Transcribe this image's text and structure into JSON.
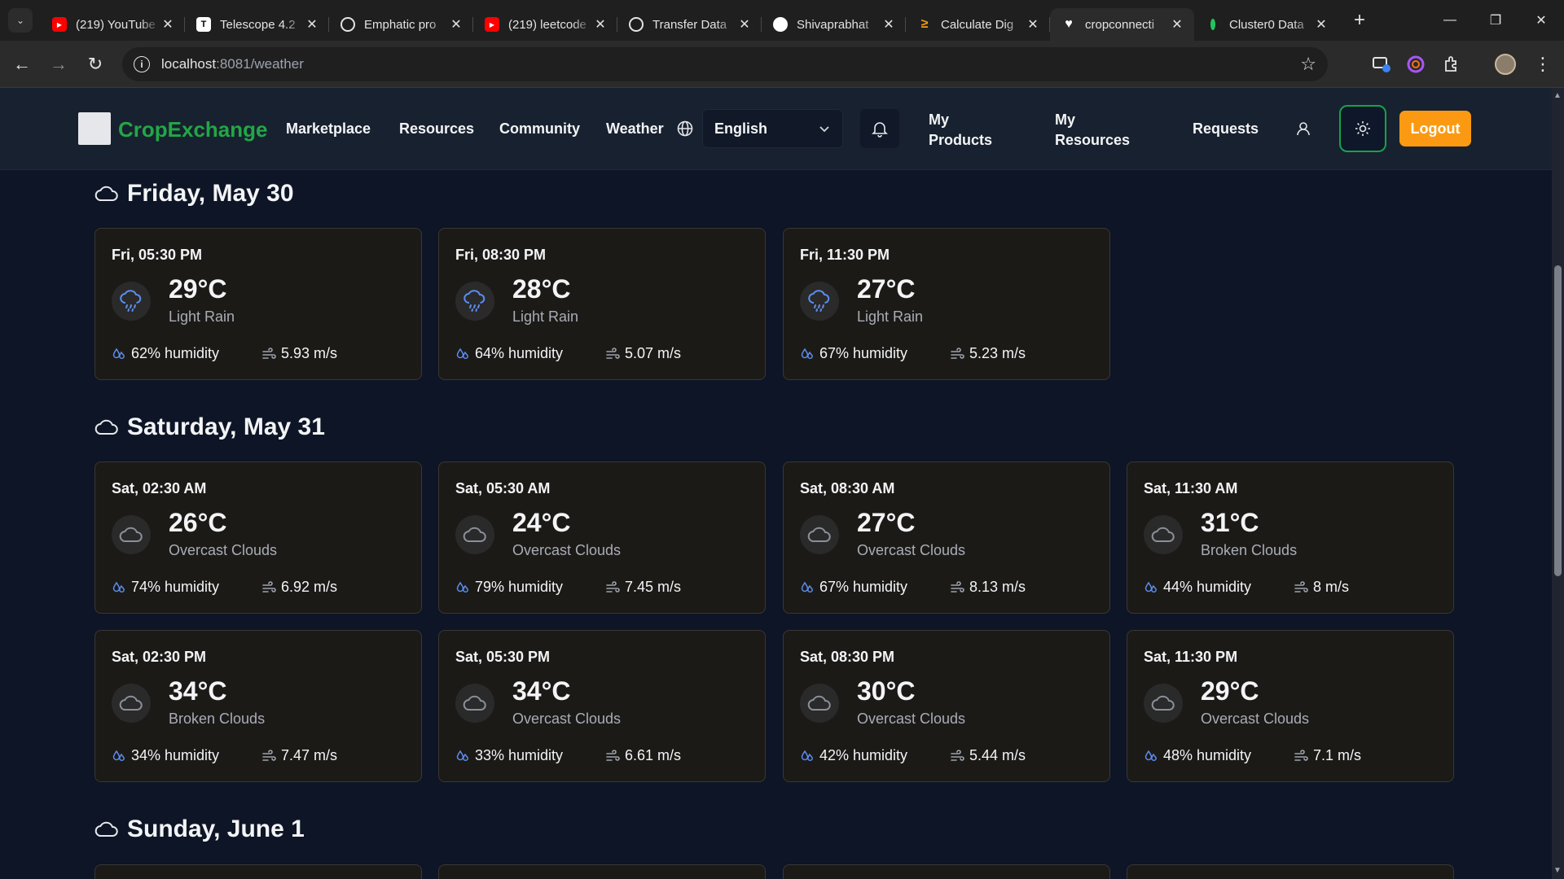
{
  "browser": {
    "tabs": [
      {
        "title": "(219) YouTube",
        "favicon": "youtube-icon",
        "color": "#ff0000"
      },
      {
        "title": "Telescope 4.2",
        "favicon": "telescope-icon",
        "color": "#ffffff"
      },
      {
        "title": "Emphatic pro",
        "favicon": "openai-icon",
        "color": "#ffffff"
      },
      {
        "title": "(219) leetcode",
        "favicon": "youtube-icon",
        "color": "#ff0000"
      },
      {
        "title": "Transfer Data",
        "favicon": "openai-icon",
        "color": "#ffffff"
      },
      {
        "title": "Shivaprabhat",
        "favicon": "github-icon",
        "color": "#ffffff"
      },
      {
        "title": "Calculate Dig",
        "favicon": "codeforces-icon",
        "color": "#f59e0b"
      },
      {
        "title": "cropconnecti",
        "favicon": "heart-icon",
        "color": "#ffffff",
        "active": true
      },
      {
        "title": "Cluster0 Data",
        "favicon": "mongodb-leaf-icon",
        "color": "#22c55e"
      }
    ],
    "url_host": "localhost",
    "url_path": ":8081/weather"
  },
  "header": {
    "brand": "CropExchange",
    "nav": {
      "marketplace": "Marketplace",
      "resources": "Resources",
      "community": "Community",
      "weather": "Weather",
      "my_products": "My Products",
      "my_resources": "My Resources",
      "requests": "Requests"
    },
    "language": "English",
    "logout": "Logout",
    "accent": "#22a746",
    "logout_color": "#fb9a12"
  },
  "days": [
    {
      "title": "Friday, May 30",
      "cards": [
        {
          "time": "Fri, 05:30 PM",
          "temp": "29°C",
          "condition": "Light Rain",
          "humidity": "62% humidity",
          "wind": "5.93 m/s",
          "icon": "rain-icon"
        },
        {
          "time": "Fri, 08:30 PM",
          "temp": "28°C",
          "condition": "Light Rain",
          "humidity": "64% humidity",
          "wind": "5.07 m/s",
          "icon": "rain-icon"
        },
        {
          "time": "Fri, 11:30 PM",
          "temp": "27°C",
          "condition": "Light Rain",
          "humidity": "67% humidity",
          "wind": "5.23 m/s",
          "icon": "rain-icon"
        }
      ]
    },
    {
      "title": "Saturday, May 31",
      "cards": [
        {
          "time": "Sat, 02:30 AM",
          "temp": "26°C",
          "condition": "Overcast Clouds",
          "humidity": "74% humidity",
          "wind": "6.92 m/s",
          "icon": "cloud-icon"
        },
        {
          "time": "Sat, 05:30 AM",
          "temp": "24°C",
          "condition": "Overcast Clouds",
          "humidity": "79% humidity",
          "wind": "7.45 m/s",
          "icon": "cloud-icon"
        },
        {
          "time": "Sat, 08:30 AM",
          "temp": "27°C",
          "condition": "Overcast Clouds",
          "humidity": "67% humidity",
          "wind": "8.13 m/s",
          "icon": "cloud-icon"
        },
        {
          "time": "Sat, 11:30 AM",
          "temp": "31°C",
          "condition": "Broken Clouds",
          "humidity": "44% humidity",
          "wind": "8 m/s",
          "icon": "cloud-icon"
        },
        {
          "time": "Sat, 02:30 PM",
          "temp": "34°C",
          "condition": "Broken Clouds",
          "humidity": "34% humidity",
          "wind": "7.47 m/s",
          "icon": "cloud-icon"
        },
        {
          "time": "Sat, 05:30 PM",
          "temp": "34°C",
          "condition": "Overcast Clouds",
          "humidity": "33% humidity",
          "wind": "6.61 m/s",
          "icon": "cloud-icon"
        },
        {
          "time": "Sat, 08:30 PM",
          "temp": "30°C",
          "condition": "Overcast Clouds",
          "humidity": "42% humidity",
          "wind": "5.44 m/s",
          "icon": "cloud-icon"
        },
        {
          "time": "Sat, 11:30 PM",
          "temp": "29°C",
          "condition": "Overcast Clouds",
          "humidity": "48% humidity",
          "wind": "7.1 m/s",
          "icon": "cloud-icon"
        }
      ]
    },
    {
      "title": "Sunday, June 1",
      "cards": []
    }
  ]
}
